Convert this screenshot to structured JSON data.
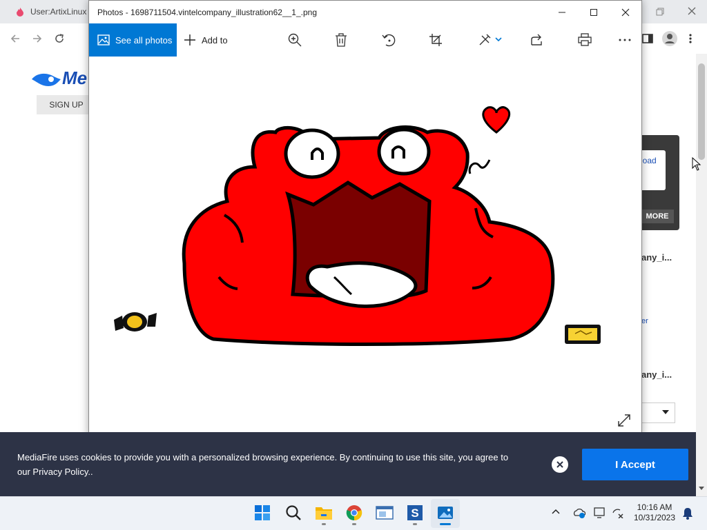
{
  "browser": {
    "tab_title": "User:ArtixLinux |",
    "mediafire_logo": "Me",
    "signup_label": "SIGN UP",
    "download_label": "load",
    "more_label": "MORE",
    "side_cards": [
      "any_i...",
      "er",
      "any_i..."
    ]
  },
  "photos": {
    "title": "Photos - 1698711504.vintelcompany_illustration62__1_.png",
    "see_all_label": "See all photos",
    "add_to_label": "Add to",
    "toolbar_icons": [
      "zoom-in-icon",
      "delete-icon",
      "rotate-icon",
      "crop-icon",
      "edit-icon",
      "share-icon",
      "print-icon",
      "more-icon"
    ]
  },
  "cookie": {
    "text": "MediaFire uses cookies to provide you with a personalized browsing experience. By continuing to use this site, you agree to our ",
    "link": "Privacy Policy",
    "suffix": "..",
    "accept_label": "I Accept"
  },
  "taskbar": {
    "time": "10:16 AM",
    "date": "10/31/2023"
  },
  "colors": {
    "accent": "#0078d4",
    "cookie_bg": "#2d3346",
    "accept": "#0a74ea",
    "monster_red": "#ff0000"
  }
}
